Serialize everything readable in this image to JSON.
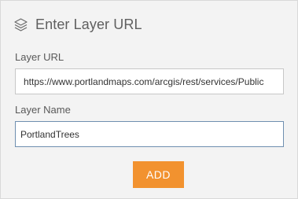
{
  "header": {
    "icon": "layers-icon",
    "title": "Enter Layer URL"
  },
  "form": {
    "url_label": "Layer URL",
    "url_value": "https://www.portlandmaps.com/arcgis/rest/services/Public",
    "name_label": "Layer Name",
    "name_value": "PortlandTrees"
  },
  "actions": {
    "add_label": "ADD"
  },
  "colors": {
    "accent": "#f2922f",
    "panel_bg": "#f3f3f3",
    "focus_border": "#6f8fb0"
  }
}
